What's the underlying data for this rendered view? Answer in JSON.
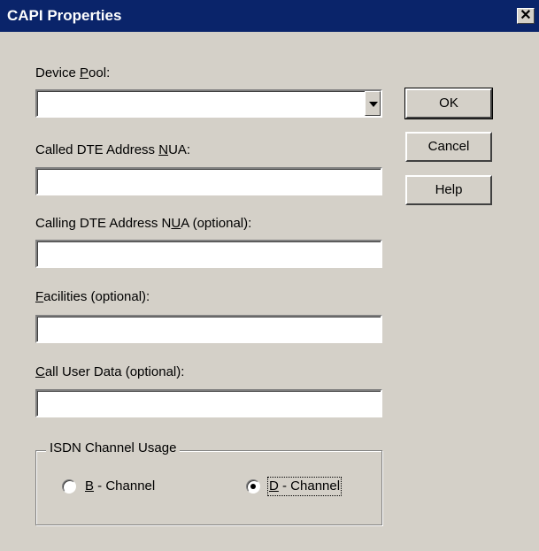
{
  "window": {
    "title": "CAPI Properties",
    "close_glyph": "✕"
  },
  "form": {
    "device_pool_label_access": "Device ",
    "device_pool_label_key": "P",
    "device_pool_label_rest": "ool:",
    "device_pool_value": "",
    "called_label_pre": "Called DTE Address ",
    "called_label_key": "N",
    "called_label_post": "UA:",
    "called_value": "",
    "calling_label_pre": "Calling DTE Address N",
    "calling_label_key": "U",
    "calling_label_post": "A (optional):",
    "calling_value": "",
    "facilities_label_key": "F",
    "facilities_label_rest": "acilities (optional):",
    "facilities_value": "",
    "cud_label_key": "C",
    "cud_label_rest": "all User Data (optional):",
    "cud_value": ""
  },
  "buttons": {
    "ok": "OK",
    "cancel": "Cancel",
    "help": "Help"
  },
  "isdn": {
    "legend": "ISDN Channel Usage",
    "b_key": "B",
    "b_rest": " - Channel",
    "d_key": "D",
    "d_rest": " - Channel",
    "selected": "D"
  }
}
